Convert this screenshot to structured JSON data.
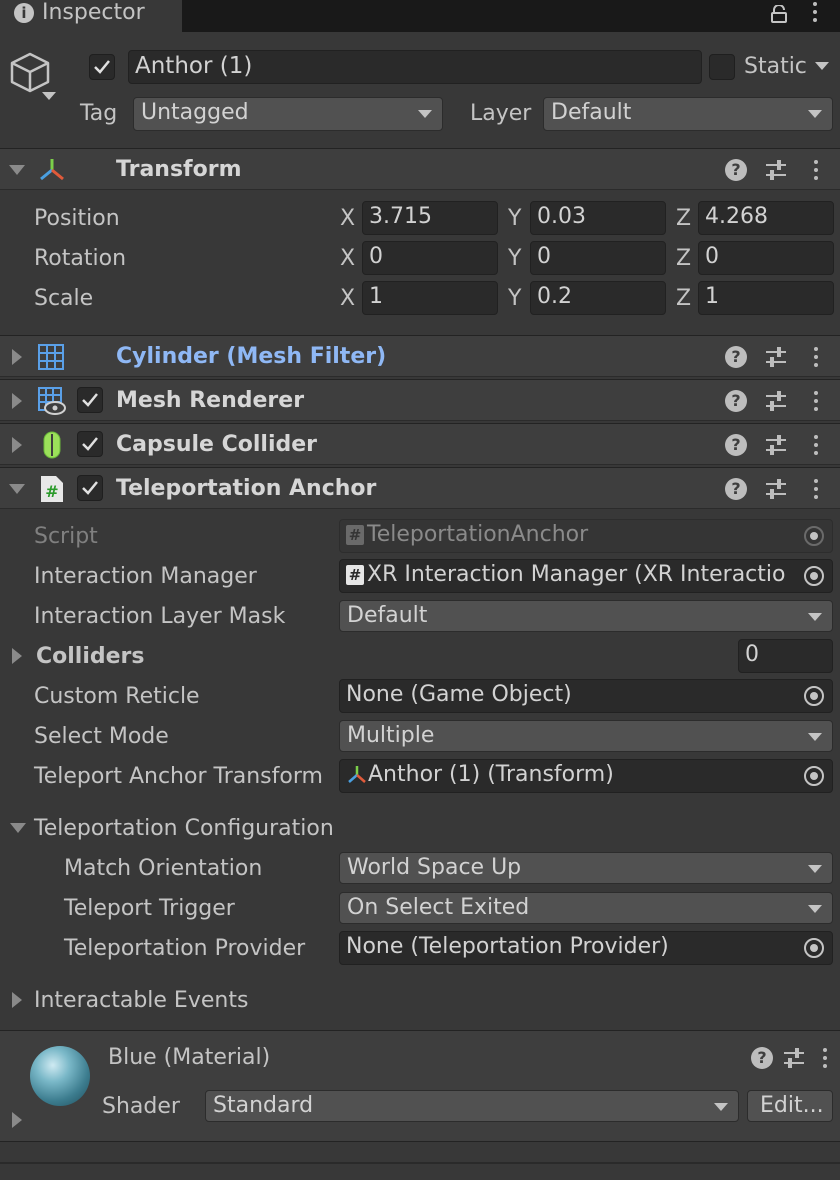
{
  "tab": {
    "title": "Inspector"
  },
  "object": {
    "name": "Anthor (1)",
    "static_label": "Static",
    "tag_label": "Tag",
    "tag_value": "Untagged",
    "layer_label": "Layer",
    "layer_value": "Default"
  },
  "transform": {
    "title": "Transform",
    "rows": [
      {
        "label": "Position",
        "x": "3.715",
        "y": "0.03",
        "z": "4.268"
      },
      {
        "label": "Rotation",
        "x": "0",
        "y": "0",
        "z": "0"
      },
      {
        "label": "Scale",
        "x": "1",
        "y": "0.2",
        "z": "1"
      }
    ],
    "axis_x": "X",
    "axis_y": "Y",
    "axis_z": "Z"
  },
  "components": {
    "mesh_filter": "Cylinder (Mesh Filter)",
    "mesh_renderer": "Mesh Renderer",
    "capsule_collider": "Capsule Collider",
    "teleport_anchor": "Teleportation Anchor"
  },
  "anchor": {
    "script_label": "Script",
    "script_value": "TeleportationAnchor",
    "manager_label": "Interaction Manager",
    "manager_value": "XR Interaction Manager (XR Interactio",
    "mask_label": "Interaction Layer Mask",
    "mask_value": "Default",
    "colliders_label": "Colliders",
    "colliders_value": "0",
    "reticle_label": "Custom Reticle",
    "reticle_value": "None (Game Object)",
    "select_label": "Select Mode",
    "select_value": "Multiple",
    "anchor_tf_label": "Teleport Anchor Transform",
    "anchor_tf_value": "Anthor (1) (Transform)",
    "config_label": "Teleportation Configuration",
    "orient_label": "Match Orientation",
    "orient_value": "World Space Up",
    "trigger_label": "Teleport Trigger",
    "trigger_value": "On Select Exited",
    "provider_label": "Teleportation Provider",
    "provider_value": "None (Teleportation Provider)",
    "events_label": "Interactable Events"
  },
  "material": {
    "name": "Blue (Material)",
    "shader_label": "Shader",
    "shader_value": "Standard",
    "edit_label": "Edit..."
  },
  "colors": {
    "accent_title": "#8fb8f5",
    "background": "#383838",
    "field": "#2a2a2a"
  }
}
